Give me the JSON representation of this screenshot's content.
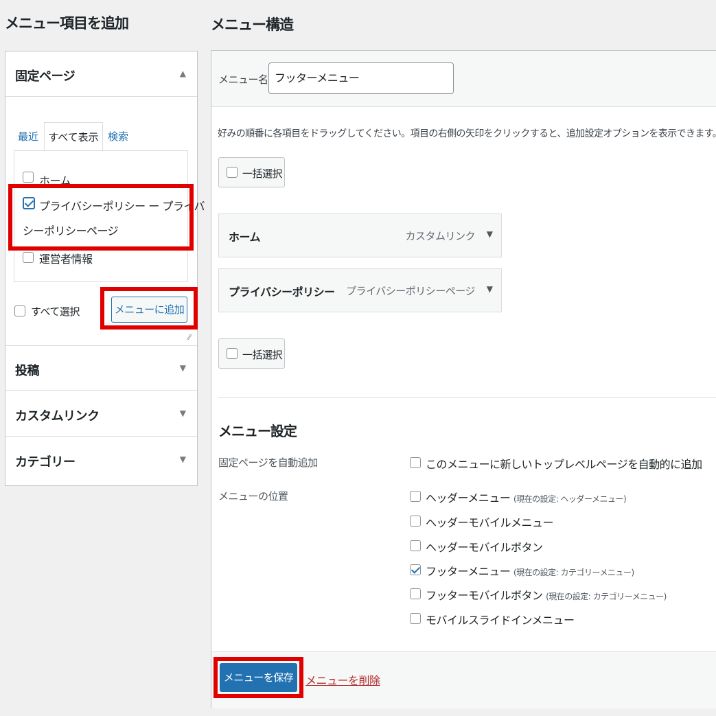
{
  "left": {
    "heading": "メニュー項目を追加",
    "sections": [
      {
        "label": "固定ページ",
        "arrow": "▲"
      },
      {
        "label": "投稿",
        "arrow": "▼"
      },
      {
        "label": "カスタムリンク",
        "arrow": "▼"
      },
      {
        "label": "カテゴリー",
        "arrow": "▼"
      }
    ],
    "tabs": [
      "最近",
      "すべて表示",
      "検索"
    ],
    "pages": [
      {
        "label": "ホーム",
        "checked": false
      },
      {
        "label_line1": "プライバシーポリシー ー プライバ",
        "label_line2": "シーポリシーページ",
        "checked": true
      },
      {
        "label": "運営者情報",
        "checked": false
      }
    ],
    "select_all": "すべて選択",
    "add_button": "メニューに追加"
  },
  "right": {
    "heading": "メニュー構造",
    "menu_name_label": "メニュー名",
    "menu_name_value": "フッターメニュー",
    "instructions": "好みの順番に各項目をドラッグしてください。項目の右側の矢印をクリックすると、追加設定オプションを表示できます。",
    "bulk_select": "一括選択",
    "items": [
      {
        "title": "ホーム",
        "type": "カスタムリンク"
      },
      {
        "title": "プライバシーポリシー",
        "type": "プライバシーポリシーページ"
      }
    ],
    "settings": {
      "heading": "メニュー設定",
      "auto_add_label": "固定ページを自動追加",
      "auto_add_option": "このメニューに新しいトップレベルページを自動的に追加",
      "location_label": "メニューの位置",
      "locations": [
        {
          "name": "ヘッダーメニュー",
          "note": "(現在の設定: ヘッダーメニュー)",
          "checked": false
        },
        {
          "name": "ヘッダーモバイルメニュー",
          "note": "",
          "checked": false
        },
        {
          "name": "ヘッダーモバイルボタン",
          "note": "",
          "checked": false
        },
        {
          "name": "フッターメニュー",
          "note": "(現在の設定: カテゴリーメニュー)",
          "checked": true
        },
        {
          "name": "フッターモバイルボタン",
          "note": "(現在の設定: カテゴリーメニュー)",
          "checked": false
        },
        {
          "name": "モバイルスライドインメニュー",
          "note": "",
          "checked": false
        }
      ]
    },
    "save_button": "メニューを保存",
    "delete_link": "メニューを削除"
  },
  "colors": {
    "accent": "#2271b1",
    "highlight": "#e00000",
    "delete": "#b32d2e"
  }
}
